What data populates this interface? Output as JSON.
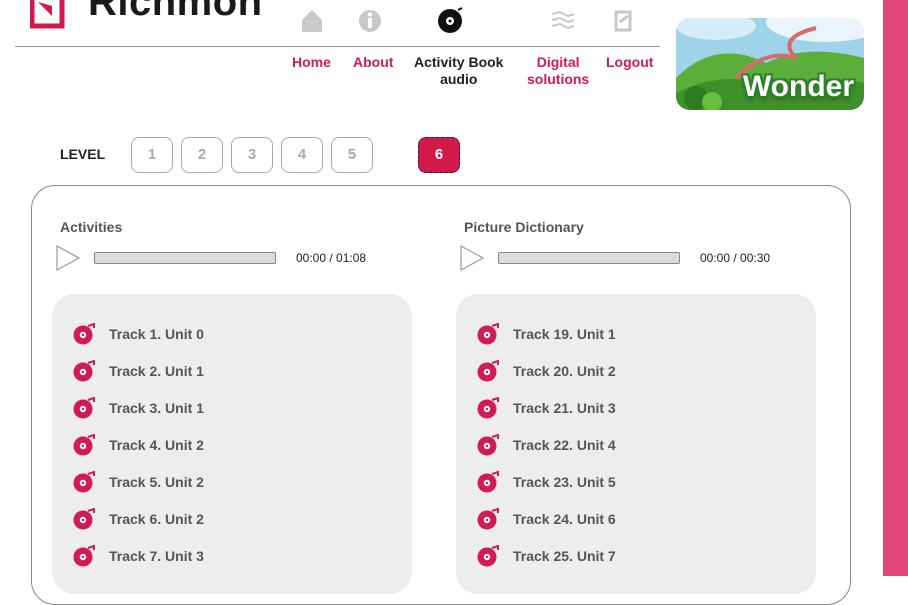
{
  "brand": {
    "logo_text": "Richmond",
    "product_badge": "Wonder"
  },
  "nav": {
    "items": [
      {
        "line1": "Home",
        "line2": ""
      },
      {
        "line1": "About",
        "line2": ""
      },
      {
        "line1": "Activity Book",
        "line2": "audio"
      },
      {
        "line1": "Digital",
        "line2": "solutions"
      },
      {
        "line1": "Logout",
        "line2": ""
      }
    ],
    "active_index": 2
  },
  "level": {
    "label": "LEVEL",
    "options": [
      "1",
      "2",
      "3",
      "4",
      "5",
      "6"
    ],
    "selected": "6"
  },
  "activities": {
    "title": "Activities",
    "time": "00:00 / 01:08",
    "tracks": [
      "Track 1. Unit 0",
      "Track 2. Unit 1",
      "Track 3. Unit 1",
      "Track 4. Unit 2",
      "Track 5. Unit 2",
      "Track 6. Unit 2",
      "Track 7. Unit 3"
    ]
  },
  "dictionary": {
    "title": "Picture Dictionary",
    "time": "00:00 / 00:30",
    "tracks": [
      "Track 19. Unit 1",
      "Track 20. Unit 2",
      "Track 21. Unit 3",
      "Track 22. Unit 4",
      "Track 23. Unit 5",
      "Track 24. Unit 6",
      "Track 25. Unit 7"
    ]
  },
  "colors": {
    "accent": "#d11a58",
    "sidebar": "#e1467a",
    "active_level": "#d11a4a"
  }
}
